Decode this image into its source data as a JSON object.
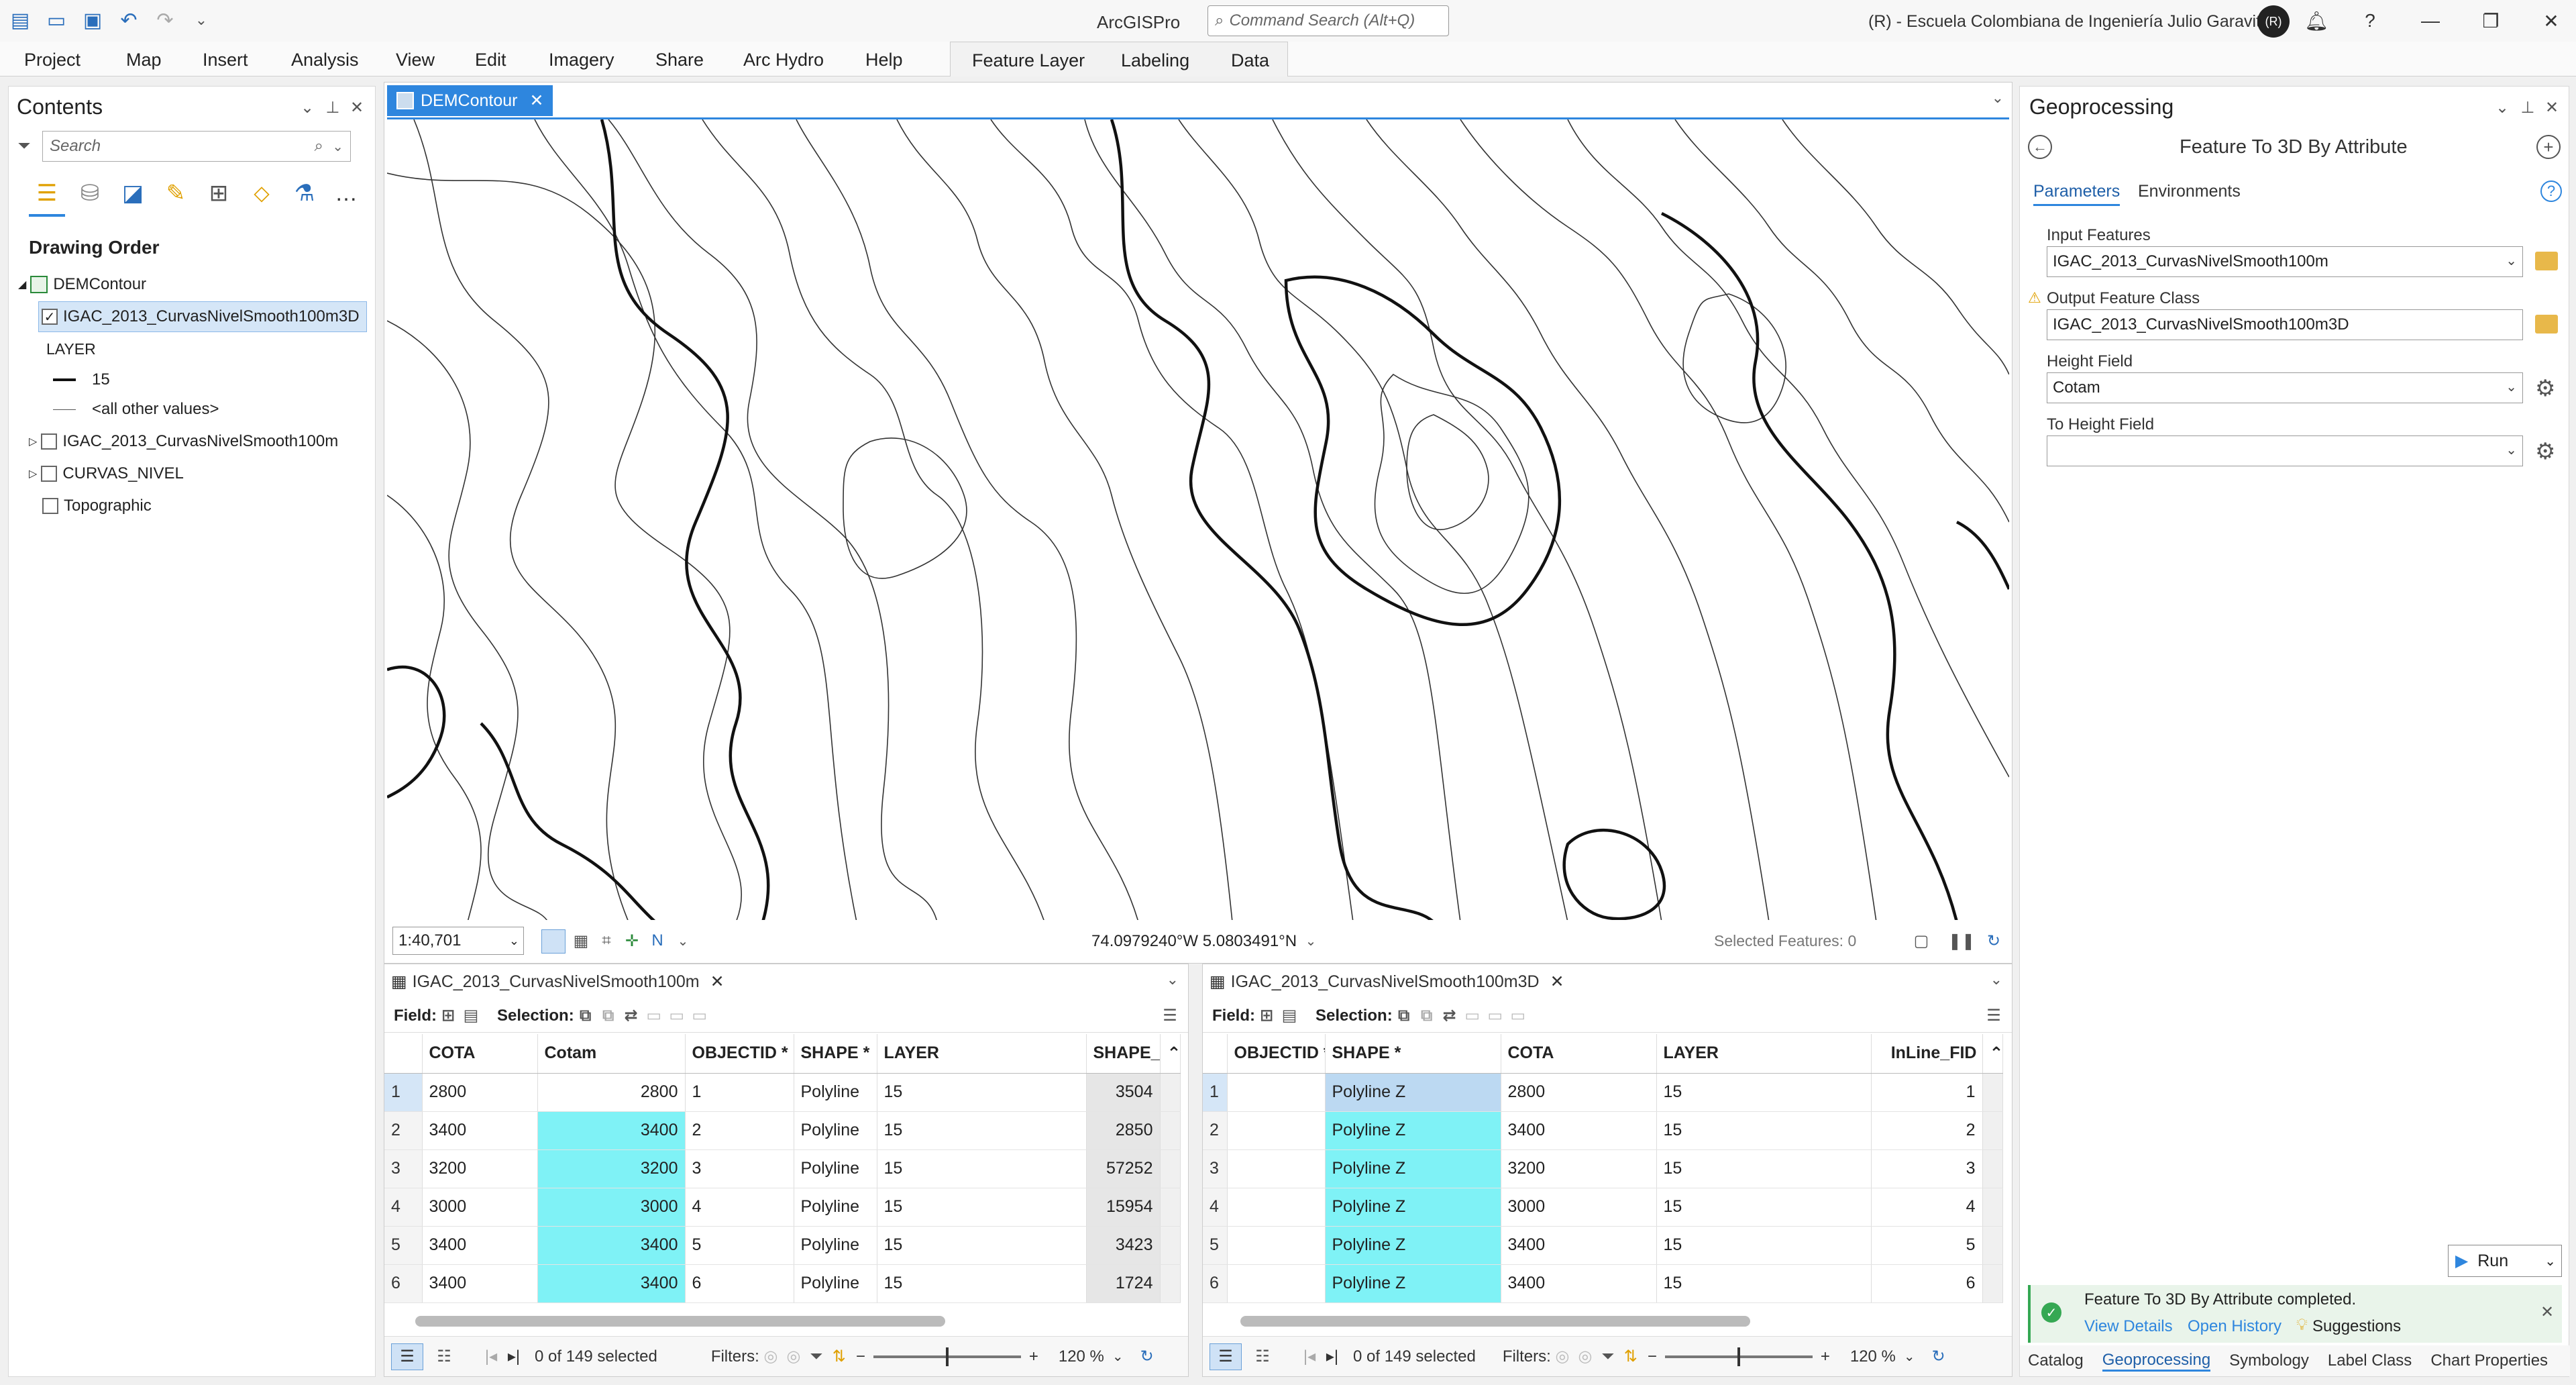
{
  "titlebar": {
    "app_title": "ArcGISPro",
    "command_search_placeholder": "Command Search (Alt+Q)",
    "organization": "(R) - Escuela Colombiana de Ingeniería Julio Garavito",
    "avatar_initials": "(R)"
  },
  "ribbon": {
    "tabs": [
      "Project",
      "Map",
      "Insert",
      "Analysis",
      "View",
      "Edit",
      "Imagery",
      "Share",
      "Arc Hydro",
      "Help"
    ],
    "context_tabs": [
      "Feature Layer",
      "Labeling",
      "Data"
    ]
  },
  "contents": {
    "title": "Contents",
    "search_placeholder": "Search",
    "drawing_order": "Drawing Order",
    "map_name": "DEMContour",
    "layers": [
      {
        "name": "IGAC_2013_CurvasNivelSmooth100m3D",
        "checked": true
      },
      {
        "name": "IGAC_2013_CurvasNivelSmooth100m",
        "checked": false
      },
      {
        "name": "CURVAS_NIVEL",
        "checked": false
      },
      {
        "name": "Topographic",
        "checked": false
      }
    ],
    "legend_heading": "LAYER",
    "legend_items": [
      "15",
      "<all other values>"
    ]
  },
  "map": {
    "tab_label": "DEMContour",
    "scale": "1:40,701",
    "coordinates": "74.0979240°W 5.0803491°N",
    "selected_features": "Selected Features: 0"
  },
  "table1": {
    "tab_label": "IGAC_2013_CurvasNivelSmooth100m",
    "field_label": "Field:",
    "selection_label": "Selection:",
    "columns": [
      "COTA",
      "Cotam",
      "OBJECTID *",
      "SHAPE *",
      "LAYER",
      "SHAPE_"
    ],
    "rows": [
      [
        "1",
        "2800",
        "2800",
        "1",
        "Polyline",
        "15",
        "3504"
      ],
      [
        "2",
        "3400",
        "3400",
        "2",
        "Polyline",
        "15",
        "2850"
      ],
      [
        "3",
        "3200",
        "3200",
        "3",
        "Polyline",
        "15",
        "57252"
      ],
      [
        "4",
        "3000",
        "3000",
        "4",
        "Polyline",
        "15",
        "15954"
      ],
      [
        "5",
        "3400",
        "3400",
        "5",
        "Polyline",
        "15",
        "3423"
      ],
      [
        "6",
        "3400",
        "3400",
        "6",
        "Polyline",
        "15",
        "1724"
      ]
    ],
    "selected_count": "0 of 149 selected",
    "filters_label": "Filters:",
    "zoom": "120 %"
  },
  "table2": {
    "tab_label": "IGAC_2013_CurvasNivelSmooth100m3D",
    "field_label": "Field:",
    "selection_label": "Selection:",
    "columns": [
      "OBJECTID *",
      "SHAPE *",
      "COTA",
      "LAYER",
      "InLine_FID"
    ],
    "rows": [
      [
        "1",
        "",
        "Polyline Z",
        "2800",
        "15",
        "1"
      ],
      [
        "2",
        "",
        "Polyline Z",
        "3400",
        "15",
        "2"
      ],
      [
        "3",
        "",
        "Polyline Z",
        "3200",
        "15",
        "3"
      ],
      [
        "4",
        "",
        "Polyline Z",
        "3000",
        "15",
        "4"
      ],
      [
        "5",
        "",
        "Polyline Z",
        "3400",
        "15",
        "5"
      ],
      [
        "6",
        "",
        "Polyline Z",
        "3400",
        "15",
        "6"
      ]
    ],
    "selected_count": "0 of 149 selected",
    "filters_label": "Filters:",
    "zoom": "120 %"
  },
  "geoprocessing": {
    "title": "Geoprocessing",
    "tool_name": "Feature To 3D By Attribute",
    "tabs": [
      "Parameters",
      "Environments"
    ],
    "input_features_label": "Input  Features",
    "input_features_value": "IGAC_2013_CurvasNivelSmooth100m",
    "output_label": "Output Feature Class",
    "output_value": "IGAC_2013_CurvasNivelSmooth100m3D",
    "height_field_label": "Height Field",
    "height_field_value": "Cotam",
    "to_height_field_label": "To Height Field",
    "to_height_field_value": "",
    "run_label": "Run",
    "completed_message": "Feature To 3D By Attribute completed.",
    "view_details": "View Details",
    "open_history": "Open History",
    "suggestions": "Suggestions",
    "bottom_tabs": [
      "Catalog",
      "Geoprocessing",
      "Symbology",
      "Label Class",
      "Chart Properties"
    ]
  },
  "colors": {
    "accent": "#2e86de",
    "highlight_cyan": "#7ff2f6"
  }
}
